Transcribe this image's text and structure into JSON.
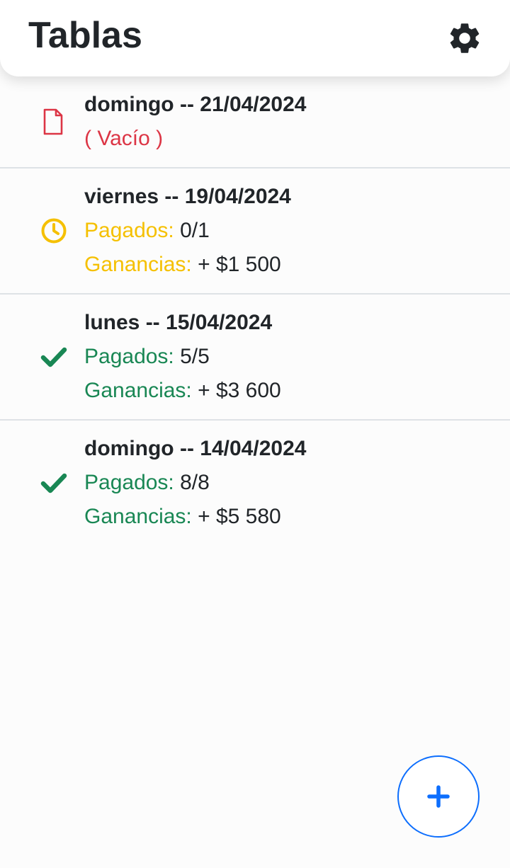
{
  "header": {
    "title": "Tablas",
    "settings_icon": "gear-icon"
  },
  "colors": {
    "empty": "#dc3545",
    "pending": "#f5c000",
    "paid": "#198754",
    "primary": "#0d6efd",
    "text": "#212529"
  },
  "tables": [
    {
      "title": "domingo -- 21/04/2024",
      "status": "empty",
      "icon": "file-icon",
      "empty_label": "( Vacío )"
    },
    {
      "title": "viernes -- 19/04/2024",
      "status": "pending",
      "icon": "clock-icon",
      "paid_label": "Pagados:",
      "paid_value": "0/1",
      "earnings_label": "Ganancias:",
      "earnings_value": "+ $1 500"
    },
    {
      "title": "lunes -- 15/04/2024",
      "status": "paid",
      "icon": "check-icon",
      "paid_label": "Pagados:",
      "paid_value": "5/5",
      "earnings_label": "Ganancias:",
      "earnings_value": "+ $3 600"
    },
    {
      "title": "domingo -- 14/04/2024",
      "status": "paid",
      "icon": "check-icon",
      "paid_label": "Pagados:",
      "paid_value": "8/8",
      "earnings_label": "Ganancias:",
      "earnings_value": "+ $5 580"
    }
  ],
  "fab": {
    "icon": "plus-icon"
  }
}
